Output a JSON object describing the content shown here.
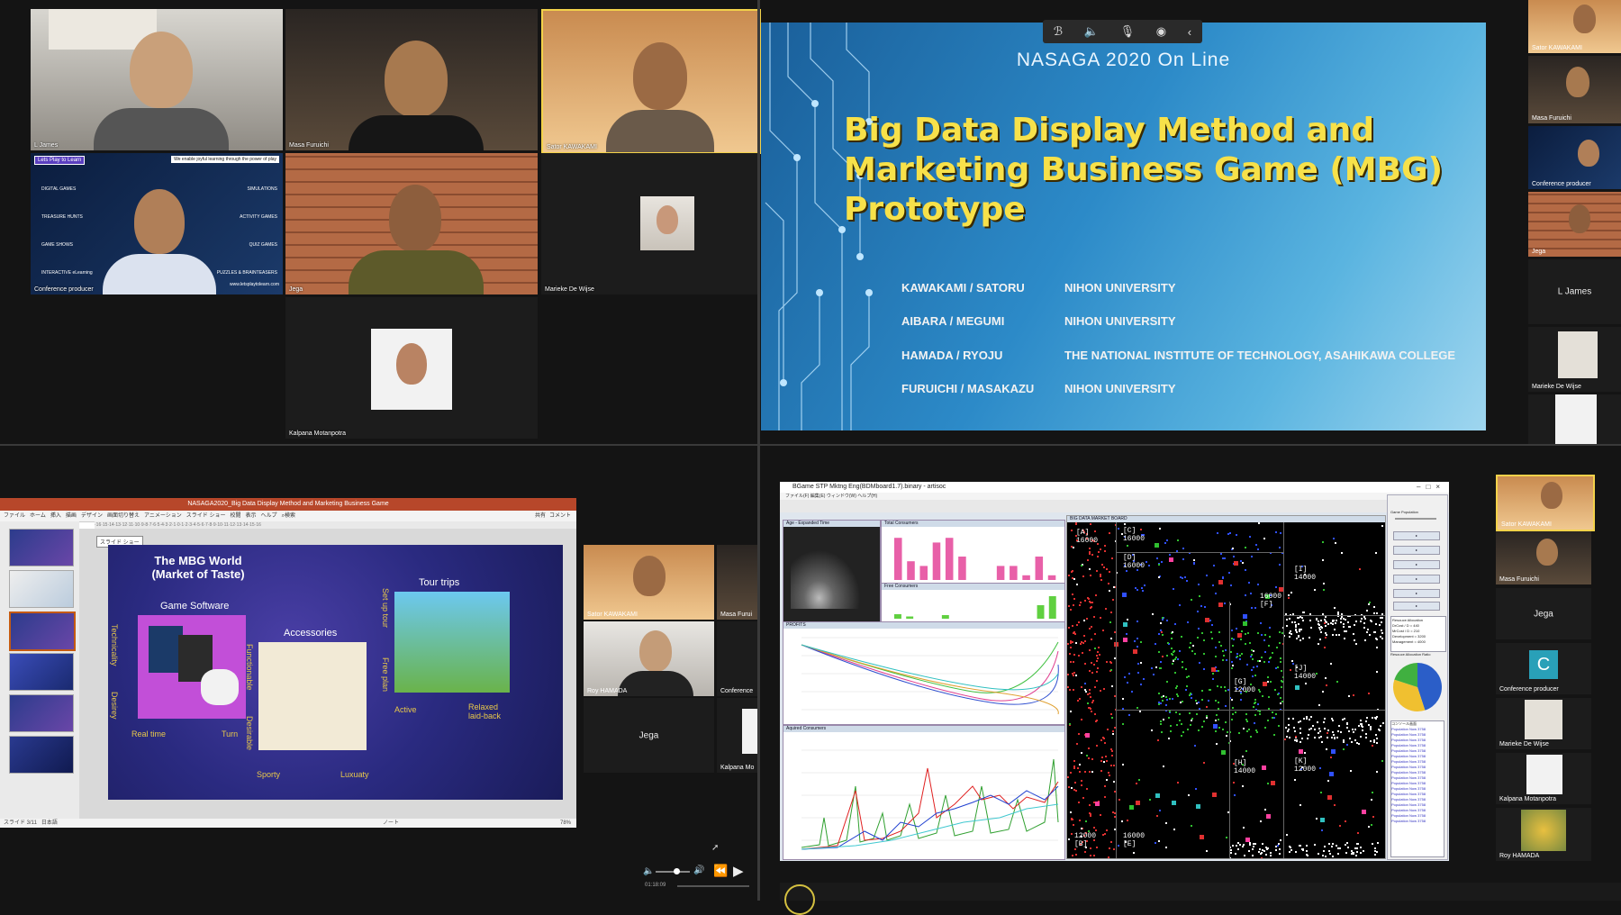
{
  "participants": {
    "l_james": "L James",
    "masa_furuichi": "Masa Furuichi",
    "sator_kawakami": "Sator KAWAKAMI",
    "conference_producer": "Conference producer",
    "jega": "Jega",
    "marieke": "Marieke De Wijse",
    "kalpana": "Kalpana Motanpotra",
    "roy_hamada": "Roy HAMADA",
    "letsplay_logo": "Lets Play to Learn",
    "letsplay_tagline": "We enable joyful learning through the power of play",
    "letsplay_left": [
      "DIGITAL GAMES",
      "TREASURE HUNTS",
      "GAME SHOWS",
      "INTERACTIVE eLearning"
    ],
    "letsplay_right": [
      "SIMULATIONS",
      "ACTIVITY GAMES",
      "QUIZ GAMES",
      "PUZZLES & BRAINTEASERS"
    ],
    "letsplay_url": "www.letsplaytolearn.com",
    "avatar_letter": "C",
    "masa_short": "Masa Furui",
    "conference_short": "Conference",
    "kalpana_short": "Kalpana Mo"
  },
  "slide": {
    "conference": "NASAGA 2020 On Line",
    "title_lines": [
      "Big Data Display Method and",
      "Marketing Business Game (MBG)",
      "Prototype"
    ],
    "authors": [
      {
        "name": "KAWAKAMI / SATORU",
        "affiliation": "NIHON UNIVERSITY"
      },
      {
        "name": "AIBARA / MEGUMI",
        "affiliation": "NIHON UNIVERSITY"
      },
      {
        "name": "HAMADA / RYOJU",
        "affiliation": "THE NATIONAL INSTITUTE OF TECHNOLOGY, ASAHIKAWA COLLEGE"
      },
      {
        "name": "FURUICHI / MASAKAZU",
        "affiliation": "NIHON UNIVERSITY"
      }
    ]
  },
  "toolbar_icons": [
    "bluetooth-icon",
    "speaker-icon",
    "microphone-icon",
    "broadcast-icon",
    "chevron-left-icon"
  ],
  "ppt": {
    "window_title": "NASAGA2020_Big Data Display Method and Marketing Business Game",
    "ribbon_tabs": [
      "ファイル",
      "ホーム",
      "挿入",
      "描画",
      "デザイン",
      "画面切り替え",
      "アニメーション",
      "スライド ショー",
      "校閲",
      "表示",
      "ヘルプ",
      "検索",
      "共有",
      "コメント"
    ],
    "status_left": "スライド 3/11",
    "status_lang": "日本語",
    "status_notes": "ノート",
    "zoom": "78%",
    "tooltip": "スライド ショー",
    "slide_title": "The MBG World\n(Market of Taste)",
    "game_software": "Game Software",
    "accessories": "Accessories",
    "tour_trips": "Tour trips",
    "real_time": "Real time",
    "turn": "Turn",
    "technicality": "Technicality",
    "desirey": "Desirey",
    "functionable": "Functionable",
    "desirable": "Desirable",
    "sporty": "Sporty",
    "luxuary": "Luxuaty",
    "active": "Active",
    "relaxed": "Relaxed\nlaid-back",
    "set_up_tour": "Set up tour",
    "free_plan": "Free plan"
  },
  "bgame": {
    "window_title": "BGame STP Mktng Eng(BDMboard1.7).binary - artisoc",
    "menu": "ファイル(F)  編集(E)  ウィンドウ(W)  ヘルプ(H)",
    "panels": {
      "age": "Age - Expanded Time",
      "total": "Total Consumers",
      "profits": "PROFITS",
      "aquired": "Aquired Consumers",
      "board": "BIG DATA MARKET BOARD",
      "free": "Free Consumers"
    },
    "zones": {
      "A": "[A]\n16000",
      "C": "[C]\n16000",
      "D": "[D]\n16000",
      "I": "[I]\n14000",
      "F": "16000\n[F]",
      "G": "[G]\n12000",
      "J": "[J]\n14000",
      "H": "[H]\n14000",
      "K": "[K]\n12000",
      "B": "12000\n[B]",
      "E": "16000\n[E]"
    },
    "side": {
      "header": "Game Population",
      "alloc_title": "Resouce Allocation",
      "alloc_lines": [
        "DrCost / D = 440",
        "MrCost / D = 210",
        "Development = 3200",
        "Management = 4000"
      ],
      "pie_title": "Resouce Allocation Ratio",
      "log_title": "コンソール画面",
      "log_line": "Population Now 3758"
    },
    "pie_values": [
      0.45,
      0.35,
      0.2
    ],
    "pie_colors": [
      "#2b5ec8",
      "#f0c030",
      "#40b040"
    ],
    "total_consumers": [
      9,
      4,
      3,
      8,
      9,
      5,
      0,
      0,
      3,
      3,
      1,
      5,
      1
    ],
    "free_consumers": [
      1,
      0.5,
      0,
      0,
      0.8,
      0,
      0,
      0,
      0,
      0,
      0,
      0,
      3,
      5
    ]
  },
  "video_controls": {
    "time": "01:18:09"
  }
}
